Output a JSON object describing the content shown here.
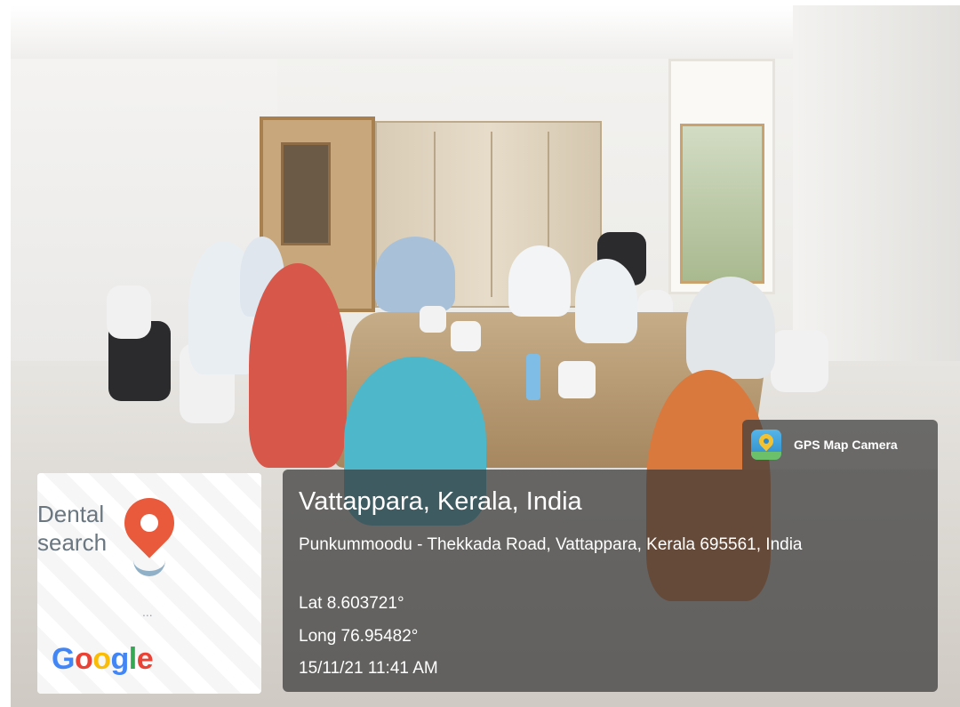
{
  "overlay": {
    "badge_label": "GPS Map Camera",
    "badge_icon": "gps-map-camera-icon",
    "location_title": "Vattappara, Kerala, India",
    "address": "Punkummoodu - Thekkada Road, Vattappara, Kerala 695561, India",
    "latitude": "Lat 8.603721°",
    "longitude": "Long 76.95482°",
    "timestamp": "15/11/21 11:41 AM"
  },
  "map": {
    "place_label_line1": "Dental",
    "place_label_line2": "search",
    "ellipsis": "...",
    "provider_logo": "Google",
    "pin_color": "#e85a3b"
  }
}
